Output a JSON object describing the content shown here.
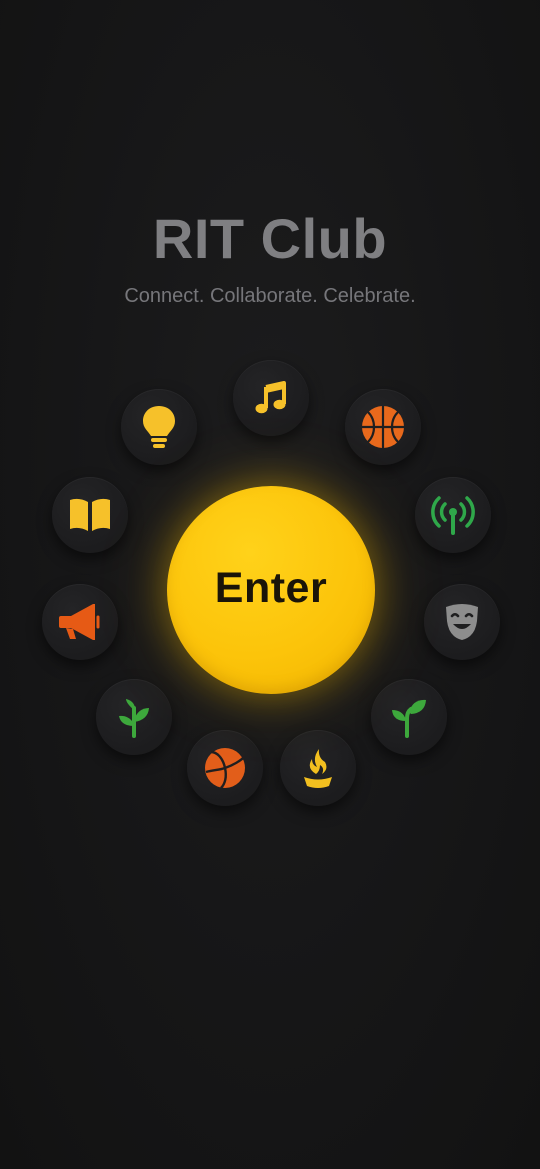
{
  "header": {
    "title": "RIT Club",
    "subtitle": "Connect. Collaborate. Celebrate."
  },
  "enter_button": {
    "label": "Enter"
  },
  "orbit_icons": [
    {
      "icon": "music-note-icon",
      "color": "#F6C12A"
    },
    {
      "icon": "basketball-icon",
      "color": "#E8691C"
    },
    {
      "icon": "broadcast-antenna-icon",
      "color": "#2FA84A"
    },
    {
      "icon": "theater-mask-icon",
      "color": "#8D8D8D"
    },
    {
      "icon": "sprout-icon",
      "color": "#3DA83C"
    },
    {
      "icon": "torch-flame-icon",
      "color": "#F2BF1F"
    },
    {
      "icon": "volleyball-icon",
      "color": "#E25E1A"
    },
    {
      "icon": "seedling-icon",
      "color": "#3DA83C"
    },
    {
      "icon": "megaphone-icon",
      "color": "#E65A15"
    },
    {
      "icon": "open-book-icon",
      "color": "#F6C12A"
    },
    {
      "icon": "lightbulb-icon",
      "color": "#F6C12A"
    }
  ],
  "colors": {
    "background": "#151515",
    "accent": "#FCC40A",
    "title": "#7F7F82"
  }
}
